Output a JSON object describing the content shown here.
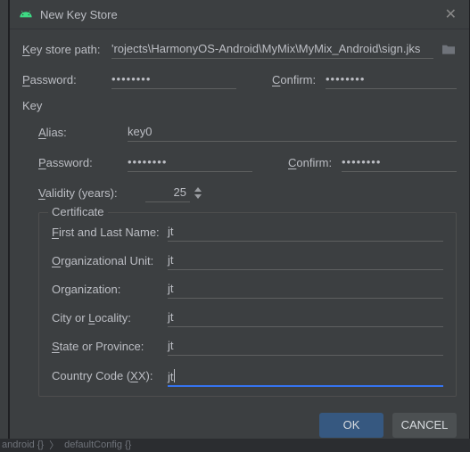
{
  "title": "New Key Store",
  "keystore": {
    "path_label_pre": "K",
    "path_label_post": "ey store path:",
    "path_value": "'rojects\\HarmonyOS-Android\\MyMix\\MyMix_Android\\sign.jks",
    "password_label_pre": "P",
    "password_label_post": "assword:",
    "password_value": "••••••••",
    "confirm_label_pre": "C",
    "confirm_label_post": "onfirm:",
    "confirm_value": "••••••••"
  },
  "key_section_title": "Key",
  "key": {
    "alias_label_pre": "A",
    "alias_label_post": "lias:",
    "alias_value": "key0",
    "password_label_pre": "P",
    "password_label_post": "assword:",
    "password_value": "••••••••",
    "confirm_label_pre": "C",
    "confirm_label_post": "onfirm:",
    "confirm_value": "••••••••",
    "validity_label_pre": "V",
    "validity_label_post": "alidity (years):",
    "validity_value": "25"
  },
  "certificate": {
    "legend": "Certificate",
    "first_last_label_pre": "F",
    "first_last_label_post": "irst and Last Name:",
    "first_last_value": "jt",
    "org_unit_label_pre": "O",
    "org_unit_label_post": "rganizational Unit:",
    "org_unit_value": "jt",
    "org_label": "Organization:",
    "org_value": "jt",
    "city_label_pre": "City or ",
    "city_label_mid": "L",
    "city_label_post": "ocality:",
    "city_value": "jt",
    "state_label_pre": "S",
    "state_label_post": "tate or Province:",
    "state_value": "jt",
    "country_label_pre": "Country Code (",
    "country_label_mid": "X",
    "country_label_post": "X):",
    "country_value": "jt"
  },
  "buttons": {
    "ok": "OK",
    "cancel": "CANCEL"
  },
  "breadcrumb": {
    "item1": "android {}",
    "sep": "〉",
    "item2": "defaultConfig {}"
  }
}
